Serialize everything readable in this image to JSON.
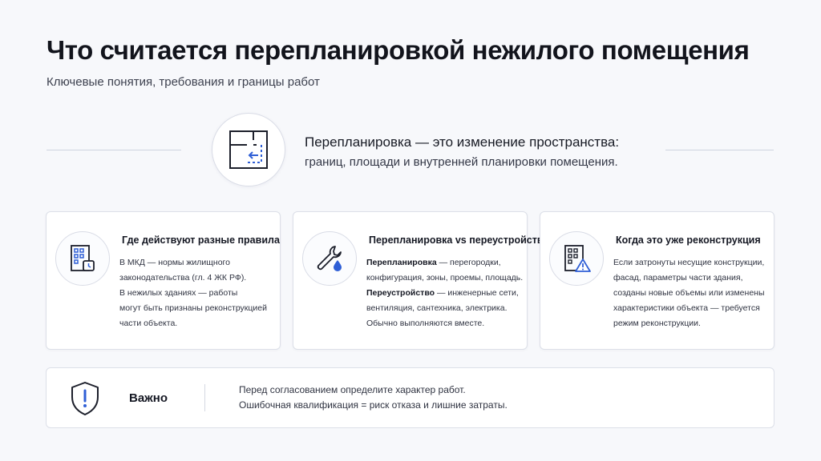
{
  "header": {
    "title": "Что считается перепланировкой нежилого помещения",
    "subtitle": "Ключевые понятия, требования и границы работ"
  },
  "definition": {
    "icon": "floor-plan-icon",
    "title": "Перепланировка — это изменение пространства:",
    "subtitle": "границ, площади и внутренней планировки помещения."
  },
  "cards": [
    {
      "icon": "building-clock-icon",
      "title": "Где действуют разные правила",
      "lines": [
        {
          "bold": "",
          "text": "В МКД — нормы жилищного"
        },
        {
          "bold": "",
          "text": "законодательства (гл. 4 ЖК РФ)."
        },
        {
          "bold": "",
          "text": "В нежилых зданиях — работы"
        },
        {
          "bold": "",
          "text": "могут быть признаны реконструкцией"
        },
        {
          "bold": "",
          "text": "части объекта."
        }
      ]
    },
    {
      "icon": "wrench-drop-icon",
      "title": "Перепланировка vs переустройство",
      "lines": [
        {
          "bold": "Перепланировка",
          "text": " — перегородки,"
        },
        {
          "bold": "",
          "text": "конфигурация, зоны, проемы, площадь."
        },
        {
          "bold": "Переустройство",
          "text": " — инженерные сети,"
        },
        {
          "bold": "",
          "text": "вентиляция, сантехника, электрика."
        },
        {
          "bold": "",
          "text": "Обычно выполняются вместе."
        }
      ]
    },
    {
      "icon": "building-warning-icon",
      "title": "Когда это уже реконструкция",
      "lines": [
        {
          "bold": "",
          "text": "Если затронуты несущие конструкции,"
        },
        {
          "bold": "",
          "text": "фасад, параметры части здания,"
        },
        {
          "bold": "",
          "text": "созданы новые объемы или изменены"
        },
        {
          "bold": "",
          "text": "характеристики объекта — требуется"
        },
        {
          "bold": "",
          "text": "режим реконструкции."
        }
      ]
    }
  ],
  "note": {
    "icon": "shield-alert-icon",
    "label": "Важно",
    "line1": "Перед согласованием определите характер работ.",
    "line2": "Ошибочная квалификация = риск отказа и лишние затраты."
  },
  "colors": {
    "accent": "#2f5fd6",
    "text": "#151823",
    "border": "#dcdfe8"
  }
}
